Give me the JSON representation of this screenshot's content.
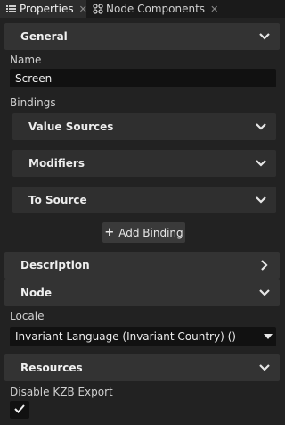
{
  "tabs": [
    {
      "label": "Properties",
      "icon": "list-icon",
      "active": true
    },
    {
      "label": "Node Components",
      "icon": "components-icon",
      "active": false
    }
  ],
  "sections": {
    "general": "General",
    "description": "Description",
    "node": "Node",
    "resources": "Resources"
  },
  "name": {
    "label": "Name",
    "value": "Screen"
  },
  "bindings": {
    "label": "Bindings",
    "value_sources": "Value Sources",
    "modifiers": "Modifiers",
    "to_source": "To Source",
    "add_binding": "Add Binding"
  },
  "locale": {
    "label": "Locale",
    "value": "Invariant Language (Invariant Country) ()"
  },
  "disable_kzb_export": {
    "label": "Disable KZB Export",
    "checked": true
  },
  "colors": {
    "background": "#222222",
    "section": "#333333",
    "field": "#111111"
  }
}
